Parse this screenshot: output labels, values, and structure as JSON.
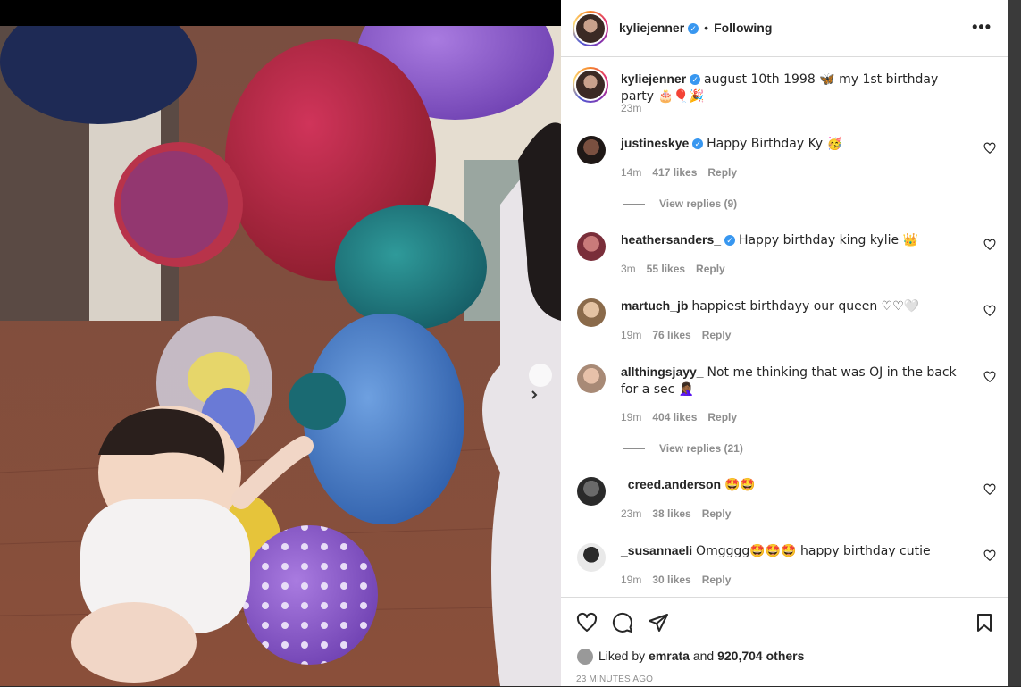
{
  "post": {
    "author": "kyliejenner",
    "follow_state": "Following",
    "caption_text": "august 10th 1998 🦋 my 1st birthday party 🎂🎈🎉",
    "caption_age": "23m",
    "liked_by_prefix": "Liked by",
    "liked_by_user": "emrata",
    "liked_by_and": "and",
    "liked_by_others": "920,704 others",
    "timestamp": "23 MINUTES AGO"
  },
  "comments": [
    {
      "user": "justineskye",
      "verified": true,
      "text": "Happy Birthday Ky 🥳",
      "age": "14m",
      "likes": "417 likes",
      "reply": "Reply",
      "view_replies": "View replies (9)"
    },
    {
      "user": "heathersanders_",
      "verified": true,
      "text": "Happy birthday king kylie 👑",
      "age": "3m",
      "likes": "55 likes",
      "reply": "Reply"
    },
    {
      "user": "martuch_jb",
      "verified": false,
      "text": "happiest birthdayy our queen ♡♡🤍",
      "age": "19m",
      "likes": "76 likes",
      "reply": "Reply"
    },
    {
      "user": "allthingsjayy_",
      "verified": false,
      "text": "Not me thinking that was OJ in the back for a sec 🤦🏾‍♀️",
      "age": "19m",
      "likes": "404 likes",
      "reply": "Reply",
      "view_replies": "View replies (21)"
    },
    {
      "user": "_creed.anderson",
      "verified": false,
      "text": "🤩🤩",
      "age": "23m",
      "likes": "38 likes",
      "reply": "Reply"
    },
    {
      "user": "_susannaeli",
      "verified": false,
      "text": "Omgggg🤩🤩🤩 happy birthday cutie",
      "age": "19m",
      "likes": "30 likes",
      "reply": "Reply"
    }
  ],
  "icons": {
    "more": "more-options-icon",
    "like": "heart-icon",
    "comment": "comment-icon",
    "share": "paper-plane-icon",
    "save": "bookmark-icon",
    "next": "chevron-right-icon"
  },
  "colors": {
    "verified": "#3897f0",
    "text": "#262626",
    "muted": "#8e8e8e",
    "divider": "#dbdbdb"
  }
}
